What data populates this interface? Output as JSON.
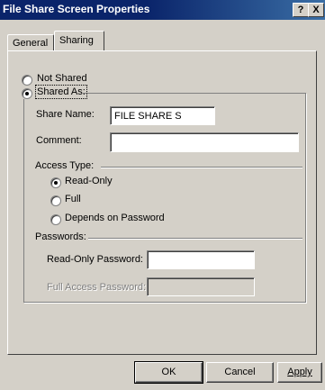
{
  "window": {
    "title": "File Share Screen Properties",
    "help_button": "?",
    "close_button": "X"
  },
  "tabs": [
    {
      "label": "General",
      "active": false
    },
    {
      "label": "Sharing",
      "active": true
    }
  ],
  "sharing": {
    "not_shared_label": "Not Shared",
    "shared_as_label": "Shared As:",
    "selected": "shared_as",
    "share_name_label": "Share Name:",
    "share_name_value": "FILE SHARE S",
    "comment_label": "Comment:",
    "comment_value": "",
    "access_type_label": "Access Type:",
    "access_options": [
      {
        "label": "Read-Only",
        "checked": true
      },
      {
        "label": "Full",
        "checked": false
      },
      {
        "label": "Depends on Password",
        "checked": false
      }
    ],
    "passwords_label": "Passwords:",
    "read_only_password_label": "Read-Only Password:",
    "read_only_password_value": "",
    "full_access_password_label": "Full Access Password:",
    "full_access_password_value": ""
  },
  "buttons": {
    "ok": "OK",
    "cancel": "Cancel",
    "apply": "Apply"
  }
}
